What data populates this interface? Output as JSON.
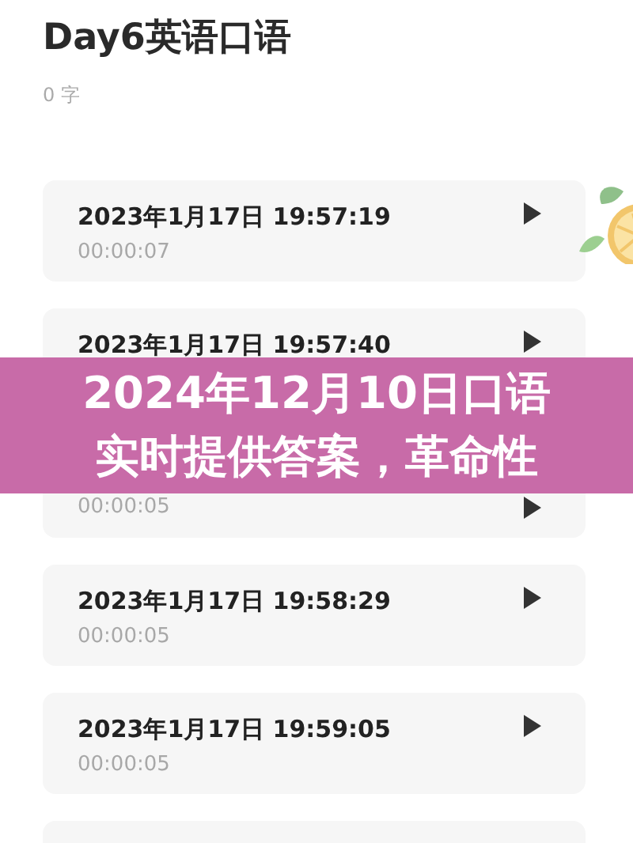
{
  "note": {
    "title": "Day6英语口语",
    "word_count": "0 字"
  },
  "recordings": [
    {
      "time": "2023年1月17日 19:57:19",
      "duration": "00:00:07"
    },
    {
      "time": "2023年1月17日 19:57:40"
    },
    {
      "duration": "00:00:05"
    },
    {
      "time": "2023年1月17日 19:58:29",
      "duration": "00:00:05"
    },
    {
      "time": "2023年1月17日 19:59:05",
      "duration": "00:00:05"
    }
  ],
  "clipped_card": true,
  "overlay_title": {
    "lines": [
      "2024年12月10日口语",
      "实时提供答案，革命性"
    ]
  }
}
